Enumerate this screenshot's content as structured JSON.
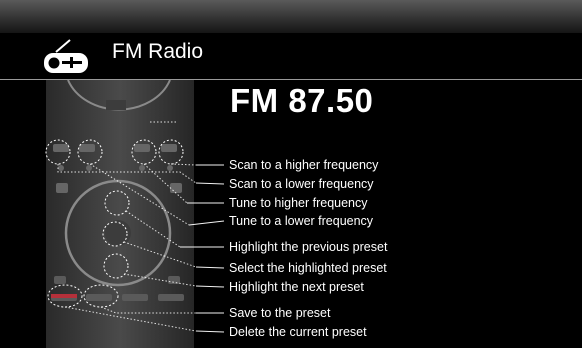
{
  "window": {
    "title": "FM Radio"
  },
  "radio": {
    "station": "FM 87.50"
  },
  "labels": [
    "Scan to a higher frequency",
    "Scan to a lower frequency",
    "Tune to higher frequency",
    "Tune to a lower frequency",
    "Highlight the previous preset",
    "Select the highlighted preset",
    "Highlight the next preset",
    "Save to the preset",
    "Delete the current preset"
  ],
  "icons": {
    "app": "radio-icon"
  },
  "colors": {
    "background": "#000000",
    "text": "#ffffff",
    "callout": "#ffffff"
  }
}
